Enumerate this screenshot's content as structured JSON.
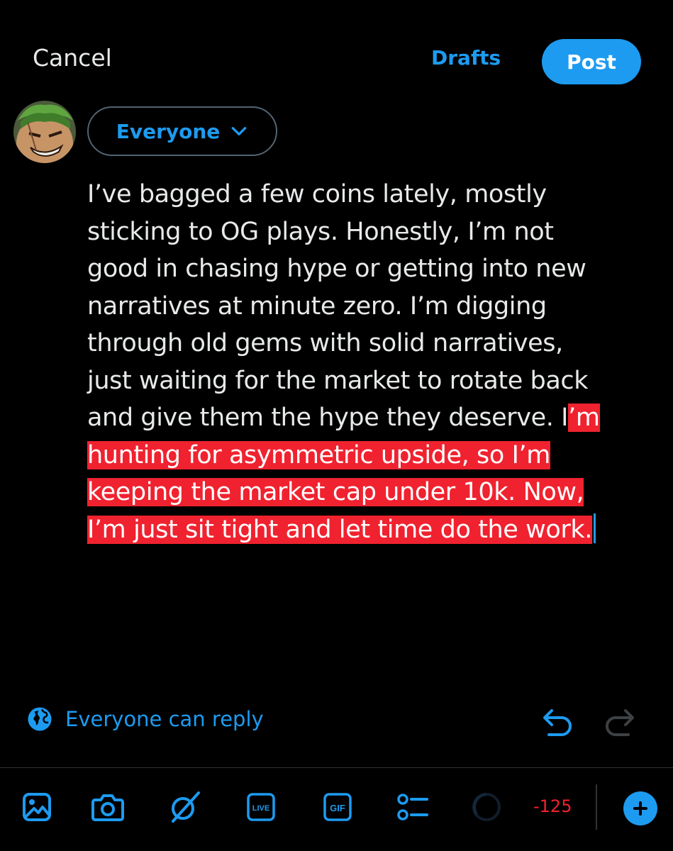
{
  "header": {
    "cancel_label": "Cancel",
    "drafts_label": "Drafts",
    "post_label": "Post"
  },
  "audience": {
    "label": "Everyone"
  },
  "composer": {
    "lines": [
      "I’ve bagged a few coins lately, mostly",
      "sticking to OG plays. Honestly, I’m not",
      "good in chasing hype or getting into new",
      "narratives at minute zero. I’m digging",
      "through old gems with solid narratives,",
      "just waiting for the market to rotate back"
    ],
    "line7_unselected": "and give them the hype they deserve. I",
    "line7_selected": "’m",
    "selected_lines": [
      "hunting for asymmetric upside, so I’m",
      "keeping the market cap under 10k. Now,",
      "I’m just sit tight and let time do the work."
    ]
  },
  "reply_setting": {
    "label": "Everyone can reply",
    "icon": "globe-icon"
  },
  "toolbar": {
    "icons": [
      "image-icon",
      "camera-icon",
      "grok-icon",
      "live-icon",
      "gif-icon",
      "poll-icon"
    ],
    "live_text": "LIVE",
    "gif_text": "GIF",
    "char_remaining": "-125"
  },
  "colors": {
    "accent": "#1d9bf0",
    "selection": "#f0222f",
    "over_limit": "#f4212e",
    "background": "#000000",
    "text": "#e7e9ea"
  }
}
